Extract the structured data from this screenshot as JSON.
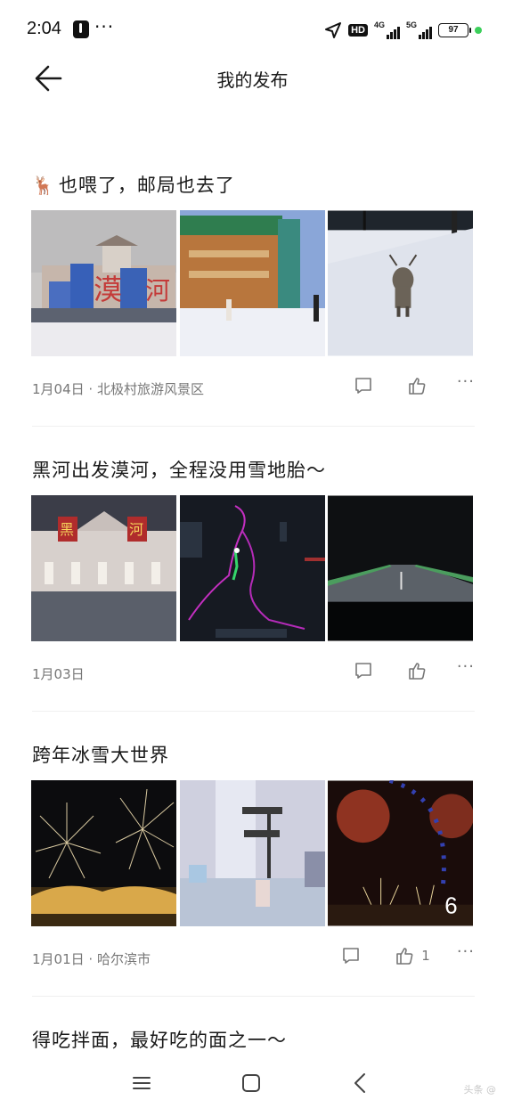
{
  "status_bar": {
    "time": "2:04",
    "overflow": "···",
    "hd": "HD",
    "net1": "4G",
    "net2": "5G",
    "battery": "97",
    "icons": [
      "tiktok-icon",
      "location-arrow-icon",
      "hd-icon",
      "signal-icon",
      "battery-icon"
    ]
  },
  "header": {
    "title": "我的发布",
    "back_icon": "arrow-left-icon"
  },
  "posts": [
    {
      "title": "也喂了，邮局也去了",
      "title_emoji": "🦌",
      "date": "1月04日",
      "location": "北极村旅游风景区",
      "photos": [
        "漠河 monument",
        "post office",
        "reindeer in snow"
      ],
      "like_count": ""
    },
    {
      "title": "黑河出发漠河，全程没用雪地胎～",
      "date": "1月03日",
      "location": "",
      "photos": [
        "黑河 gate at night",
        "car navigation map",
        "night road"
      ],
      "like_count": ""
    },
    {
      "title": "跨年冰雪大世界",
      "date": "1月01日",
      "location": "哈尔滨市",
      "photos": [
        "fireworks",
        "ice sculpture",
        "ferris wheel fireworks"
      ],
      "like_count": "1",
      "photo_count_badge": "6"
    },
    {
      "title": "得吃拌面，最好吃的面之一～"
    }
  ],
  "meta_separator": " · ",
  "nav": {
    "icons": [
      "menu-icon",
      "home-square-icon",
      "back-chevron-icon"
    ]
  },
  "watermark": "头条 @"
}
